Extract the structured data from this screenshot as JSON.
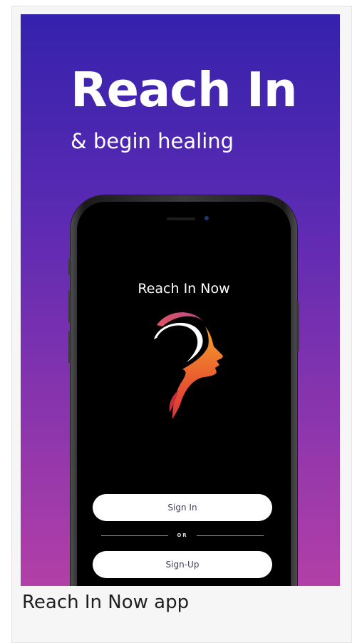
{
  "hero": {
    "title": "Reach In",
    "subtitle": "& begin healing"
  },
  "phone_screen": {
    "app_name": "Reach In Now",
    "logo_icon": "head-profile-logo-icon",
    "sign_in_label": "Sign In",
    "divider_label": "OR",
    "sign_up_label": "Sign-Up"
  },
  "caption": "Reach In Now app",
  "colors": {
    "gradient_top": "#3422ac",
    "gradient_bottom": "#b33fa7",
    "logo_orange": "#f08a2a",
    "logo_red": "#d8333a",
    "logo_pink": "#c64a86",
    "screen_bg": "#000000",
    "button_bg": "#ffffff"
  }
}
